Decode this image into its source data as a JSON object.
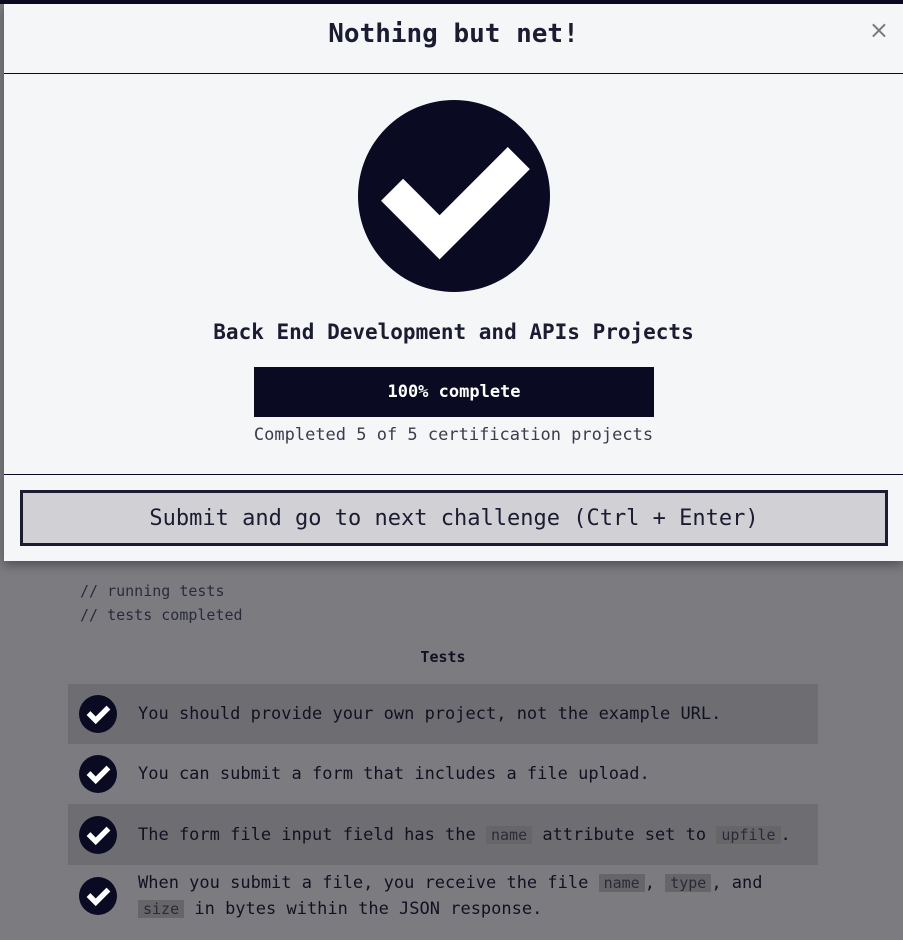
{
  "modal": {
    "title": "Nothing but net!",
    "close_label": "×",
    "certification_title": "Back End Development and APIs Projects",
    "progress": {
      "percent": 100,
      "label": "100% complete"
    },
    "completed_text": "Completed 5 of 5 certification projects",
    "submit_label": "Submit and go to next challenge (Ctrl + Enter)"
  },
  "console": {
    "lines": [
      "// running tests",
      "// tests completed"
    ]
  },
  "tests": {
    "heading": "Tests",
    "items": [
      {
        "text": "You should provide your own project, not the example URL."
      },
      {
        "text": "You can submit a form that includes a file upload."
      },
      {
        "text_a": "The form file input field has the ",
        "code_a": "name",
        "text_b": " attribute set to ",
        "code_b": "upfile",
        "text_c": "."
      },
      {
        "text_a": "When you submit a file, you receive the file ",
        "code_a": "name",
        "text_b": ", ",
        "code_b": "type",
        "text_c": ", and ",
        "code_c": "size",
        "text_d": " in bytes within the JSON response."
      }
    ]
  },
  "colors": {
    "primary_dark": "#0a0a23",
    "modal_bg": "#f5f6f7",
    "button_bg": "#d0d0d5",
    "overlay_bg": "#7c7c80"
  },
  "icons": {
    "success": "check-circle-icon",
    "test_passed": "check-circle-icon",
    "close": "close-icon"
  }
}
